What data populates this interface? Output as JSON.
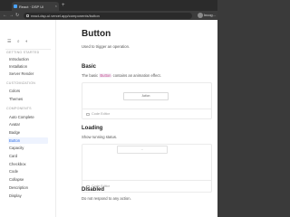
{
  "browser": {
    "tab_title": "React · DSP UI",
    "tab_close": "×",
    "new_tab": "+",
    "url": "react-dsp-ui.vercel.app/components/button",
    "profile_label": "Incog..."
  },
  "sidebar": {
    "tools": [
      "☰",
      "⌕",
      "◐"
    ],
    "sections": [
      {
        "title": "GETTING STARTED",
        "items": [
          "Introduction",
          "Installation",
          "Server Render"
        ]
      },
      {
        "title": "CUSTOMIZATION",
        "items": [
          "Colors",
          "Themes"
        ]
      },
      {
        "title": "COMPONENTS",
        "items": [
          "Auto Complete",
          "Avatar",
          "Badge",
          "Button",
          "Capacity",
          "Card",
          "Checkbox",
          "Code",
          "Collapse",
          "Description",
          "Display"
        ]
      }
    ],
    "active_item": "Button"
  },
  "main": {
    "title": "Button",
    "intro": "Used to trigger an operation.",
    "sections": [
      {
        "heading": "Basic",
        "desc_before": "The basic ",
        "desc_code": "Button",
        "desc_after": " contains an animation effect.",
        "button_label": "Action",
        "code_editor": "Code Editor"
      },
      {
        "heading": "Loading",
        "desc": "Show running status.",
        "button_label": "...",
        "code_editor": "Code Editor"
      },
      {
        "heading": "Disabled",
        "desc": "Do not respond to any action."
      }
    ]
  },
  "colors": {
    "accent": "#2e6fe8",
    "chrome": "#2b2b2b"
  }
}
